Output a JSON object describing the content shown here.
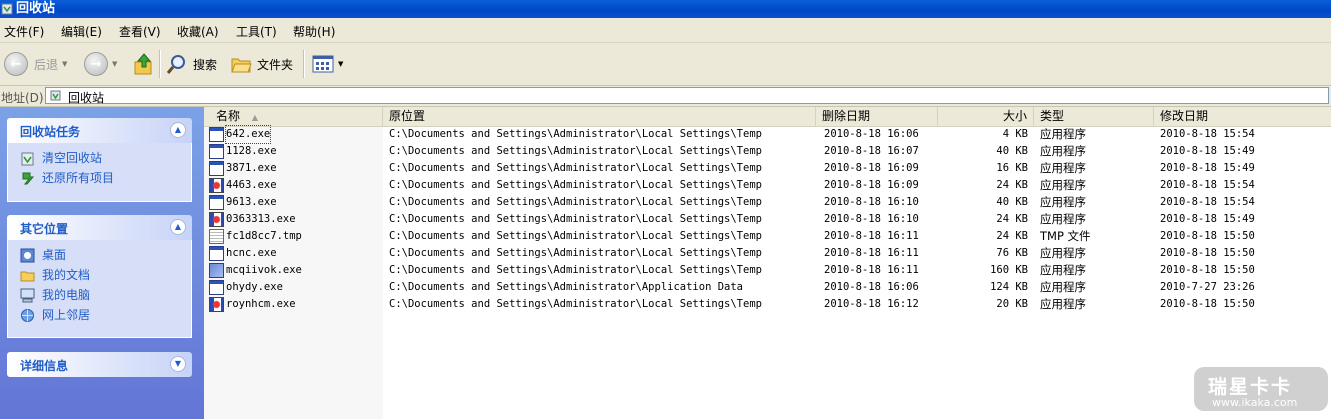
{
  "window": {
    "title": "回收站"
  },
  "menu": [
    "文件(F)",
    "编辑(E)",
    "查看(V)",
    "收藏(A)",
    "工具(T)",
    "帮助(H)"
  ],
  "toolbar": {
    "back": "后退",
    "search": "搜索",
    "folders": "文件夹"
  },
  "address": {
    "label": "地址(D)",
    "value": "回收站"
  },
  "left_pane": {
    "tasks_title": "回收站任务",
    "tasks": [
      "清空回收站",
      "还原所有项目"
    ],
    "places_title": "其它位置",
    "places": [
      "桌面",
      "我的文档",
      "我的电脑",
      "网上邻居"
    ],
    "details_title": "详细信息"
  },
  "columns": [
    "名称",
    "原位置",
    "删除日期",
    "大小",
    "类型",
    "修改日期"
  ],
  "files": [
    {
      "name": "642.exe",
      "location": "C:\\Documents and Settings\\Administrator\\Local Settings\\Temp",
      "deleted": "2010-8-18 16:06",
      "size": "4 KB",
      "type": "应用程序",
      "modified": "2010-8-18 15:54",
      "icon": "win"
    },
    {
      "name": "1128.exe",
      "location": "C:\\Documents and Settings\\Administrator\\Local Settings\\Temp",
      "deleted": "2010-8-18 16:07",
      "size": "40 KB",
      "type": "应用程序",
      "modified": "2010-8-18 15:49",
      "icon": "win"
    },
    {
      "name": "3871.exe",
      "location": "C:\\Documents and Settings\\Administrator\\Local Settings\\Temp",
      "deleted": "2010-8-18 16:09",
      "size": "16 KB",
      "type": "应用程序",
      "modified": "2010-8-18 15:49",
      "icon": "win"
    },
    {
      "name": "4463.exe",
      "location": "C:\\Documents and Settings\\Administrator\\Local Settings\\Temp",
      "deleted": "2010-8-18 16:09",
      "size": "24 KB",
      "type": "应用程序",
      "modified": "2010-8-18 15:54",
      "icon": "bug"
    },
    {
      "name": "9613.exe",
      "location": "C:\\Documents and Settings\\Administrator\\Local Settings\\Temp",
      "deleted": "2010-8-18 16:10",
      "size": "40 KB",
      "type": "应用程序",
      "modified": "2010-8-18 15:54",
      "icon": "win"
    },
    {
      "name": "0363313.exe",
      "location": "C:\\Documents and Settings\\Administrator\\Local Settings\\Temp",
      "deleted": "2010-8-18 16:10",
      "size": "24 KB",
      "type": "应用程序",
      "modified": "2010-8-18 15:49",
      "icon": "bug"
    },
    {
      "name": "fc1d8cc7.tmp",
      "location": "C:\\Documents and Settings\\Administrator\\Local Settings\\Temp",
      "deleted": "2010-8-18 16:11",
      "size": "24 KB",
      "type": "TMP 文件",
      "modified": "2010-8-18 15:50",
      "icon": "doc"
    },
    {
      "name": "hcnc.exe",
      "location": "C:\\Documents and Settings\\Administrator\\Local Settings\\Temp",
      "deleted": "2010-8-18 16:11",
      "size": "76 KB",
      "type": "应用程序",
      "modified": "2010-8-18 15:50",
      "icon": "win"
    },
    {
      "name": "mcqiivok.exe",
      "location": "C:\\Documents and Settings\\Administrator\\Local Settings\\Temp",
      "deleted": "2010-8-18 16:11",
      "size": "160 KB",
      "type": "应用程序",
      "modified": "2010-8-18 15:50",
      "icon": "app"
    },
    {
      "name": "ohydy.exe",
      "location": "C:\\Documents and Settings\\Administrator\\Application Data",
      "deleted": "2010-8-18 16:06",
      "size": "124 KB",
      "type": "应用程序",
      "modified": "2010-7-27 23:26",
      "icon": "win"
    },
    {
      "name": "roynhcm.exe",
      "location": "C:\\Documents and Settings\\Administrator\\Local Settings\\Temp",
      "deleted": "2010-8-18 16:12",
      "size": "20 KB",
      "type": "应用程序",
      "modified": "2010-8-18 15:50",
      "icon": "bug"
    }
  ],
  "watermark": {
    "line1": "瑞星卡卡",
    "line2": "www.ikaka.com"
  }
}
